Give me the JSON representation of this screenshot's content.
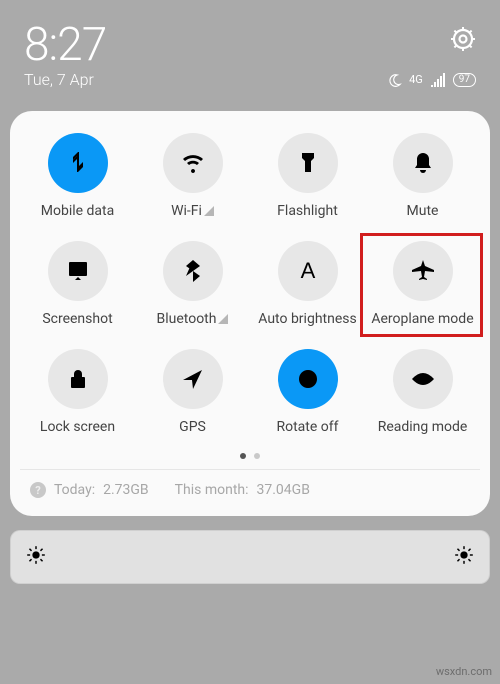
{
  "status": {
    "time": "8:27",
    "date": "Tue, 7 Apr",
    "network_label": "4G",
    "battery": "97"
  },
  "tiles": [
    {
      "label": "Mobile data",
      "active": true,
      "icon": "mobiledata",
      "hasSub": false
    },
    {
      "label": "Wi-Fi",
      "active": false,
      "icon": "wifi",
      "hasSub": true
    },
    {
      "label": "Flashlight",
      "active": false,
      "icon": "flashlight",
      "hasSub": false
    },
    {
      "label": "Mute",
      "active": false,
      "icon": "bell",
      "hasSub": false
    },
    {
      "label": "Screenshot",
      "active": false,
      "icon": "screenshot",
      "hasSub": false
    },
    {
      "label": "Bluetooth",
      "active": false,
      "icon": "bluetooth",
      "hasSub": true
    },
    {
      "label": "Auto brightness",
      "active": false,
      "icon": "letterA",
      "hasSub": false
    },
    {
      "label": "Aeroplane mode",
      "active": false,
      "icon": "airplane",
      "hasSub": false
    },
    {
      "label": "Lock screen",
      "active": false,
      "icon": "lock",
      "hasSub": false
    },
    {
      "label": "GPS",
      "active": false,
      "icon": "nav",
      "hasSub": false
    },
    {
      "label": "Rotate off",
      "active": true,
      "icon": "rotate",
      "hasSub": false
    },
    {
      "label": "Reading mode",
      "active": false,
      "icon": "eye",
      "hasSub": false
    }
  ],
  "highlight_index": 7,
  "usage": {
    "today_label": "Today:",
    "today_value": "2.73GB",
    "month_label": "This month:",
    "month_value": "37.04GB"
  },
  "watermark": "wsxdn.com"
}
